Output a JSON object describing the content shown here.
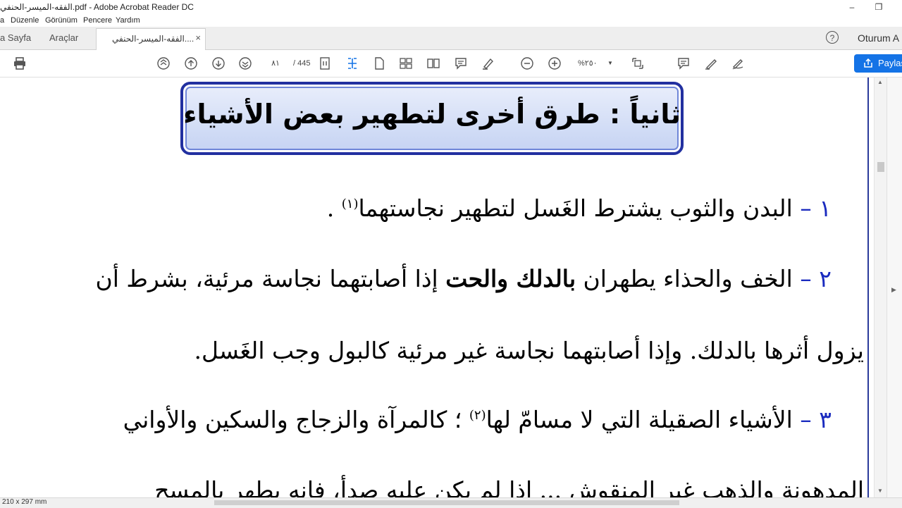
{
  "window": {
    "title": "الفقه-الميسر-الحنفي.pdf - Adobe Acrobat Reader DC",
    "minimize": "–",
    "restore": "❐"
  },
  "menu": {
    "items": [
      "a",
      "Düzenle",
      "Görünüm",
      "Pencere",
      "Yardım"
    ]
  },
  "tabs": {
    "home": "a Sayfa",
    "tools": "Araçlar",
    "document": "الفقه-الميسر-الحنفي....",
    "close": "×"
  },
  "header_right": {
    "help": "?",
    "signin": "Oturum A"
  },
  "toolbar": {
    "page_current": "٨١",
    "page_total": "/ 445",
    "zoom": "%٢٥٠",
    "share_label": "Paylaş",
    "icons": [
      "print-icon",
      "first-page-icon",
      "prev-page-icon",
      "next-page-icon",
      "last-page-icon",
      "fit-page-icon",
      "select-icon",
      "page-icon",
      "scroll-icon",
      "two-page-icon",
      "comment-icon",
      "highlight-icon",
      "zoom-out-icon",
      "zoom-in-icon",
      "fit-width-icon",
      "sticky-note-icon",
      "pen-icon",
      "sign-icon"
    ]
  },
  "document": {
    "heading": "ثانياً : طرق أخرى لتطهير بعض الأشياء",
    "lines": [
      {
        "num": "١ –",
        "text": "البدن والثوب يشترط الغَسل لتطهير نجاستهما",
        "sup": "(١)",
        "tail": "."
      },
      {
        "num": "٢ –",
        "text_a": "الخف والحذاء يطهران",
        "text_bold": "بالدلك والحت",
        "text_b": "إذا أصابتهما نجاسة مرئية، بشرط أن"
      },
      {
        "text": "يزول أثرها بالدلك. وإذا أصابتهما نجاسة غير مرئية كالبول وجب الغَسل."
      },
      {
        "num": "٣ –",
        "text_a": "الأشياء الصقيلة التي لا مسامّ لها",
        "sup": "(٢)",
        "text_b": "؛ كالمرآة والزجاج والسكين والأواني"
      },
      {
        "text": "المدهونة والذهب غير المنقوش ... إذا لم يكن عليه صدأ، فإنه يطهر بالمسح"
      }
    ]
  },
  "status": {
    "dimensions": "210 x 297 mm"
  }
}
